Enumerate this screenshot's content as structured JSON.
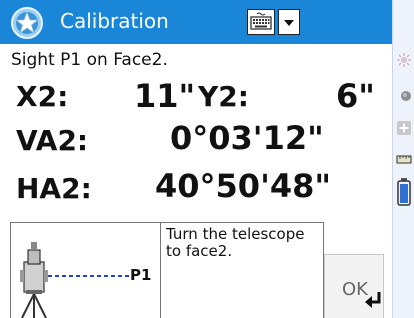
{
  "title_bar": {
    "title": "Calibration",
    "app_icon": "star-globe-icon",
    "keyboard_icon": "keyboard-icon",
    "dropdown_icon": "triangle-down-icon",
    "color": "#1a86d8"
  },
  "instruction": "Sight P1 on Face2.",
  "readings": {
    "x2_label": "X2:",
    "x2_value": "11\"",
    "y2_label": "Y2:",
    "y2_value": "6\"",
    "va2_label": "VA2:",
    "va2_value": "0°03'12\"",
    "ha2_label": "HA2:",
    "ha2_value": "40°50'48\""
  },
  "diagram": {
    "instrument_icon": "total-station-icon",
    "target_label": "P1"
  },
  "help_text": "Turn the telescope to face2.",
  "ok_button": {
    "label": "OK",
    "icon": "enter-arrow-icon"
  },
  "sidebar": {
    "icons": [
      "sun-icon",
      "satellite-icon",
      "plus-icon",
      "ruler-icon",
      "battery-icon"
    ]
  }
}
